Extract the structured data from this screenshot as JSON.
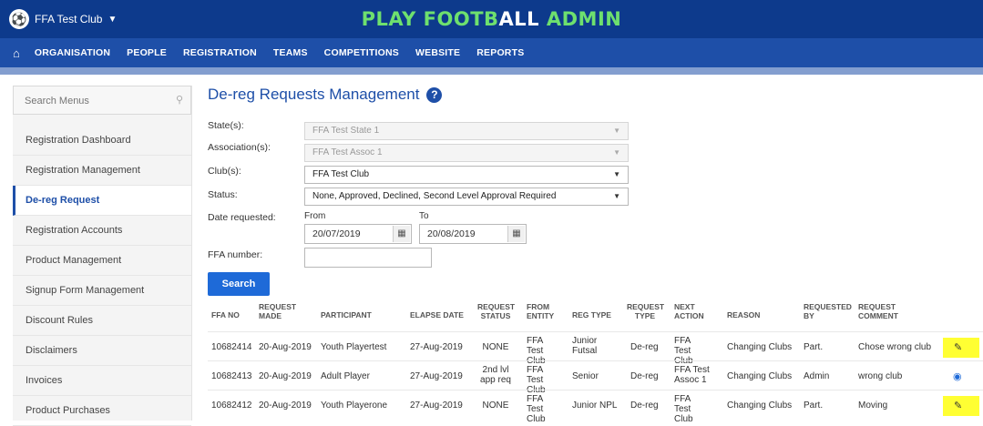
{
  "header": {
    "club_name": "FFA Test Club",
    "title_part1": "PLAY FOOTB",
    "title_part2": "ALL ",
    "title_part3": "ADMIN"
  },
  "nav": {
    "items": [
      "ORGANISATION",
      "PEOPLE",
      "REGISTRATION",
      "TEAMS",
      "COMPETITIONS",
      "WEBSITE",
      "REPORTS"
    ]
  },
  "sidebar": {
    "search_placeholder": "Search Menus",
    "items": [
      "Registration Dashboard",
      "Registration Management",
      "De-reg Request",
      "Registration Accounts",
      "Product Management",
      "Signup Form Management",
      "Discount Rules",
      "Disclaimers",
      "Invoices",
      "Product Purchases"
    ],
    "active_item": "De-reg Request"
  },
  "main": {
    "title": "De-reg Requests Management",
    "filters": {
      "state_label": "State(s):",
      "state_value": "FFA Test State 1",
      "association_label": "Association(s):",
      "association_value": "FFA Test Assoc 1",
      "club_label": "Club(s):",
      "club_value": "FFA Test Club",
      "status_label": "Status:",
      "status_value": "None, Approved, Declined, Second Level Approval Required",
      "date_label": "Date requested:",
      "from_label": "From",
      "from_value": "20/07/2019",
      "to_label": "To",
      "to_value": "20/08/2019",
      "ffa_number_label": "FFA number:",
      "ffa_number_value": ""
    },
    "search_button": "Search",
    "table": {
      "headers": [
        "FFA NO",
        "REQUEST MADE",
        "PARTICIPANT",
        "ELAPSE DATE",
        "REQUEST STATUS",
        "FROM ENTITY",
        "REG TYPE",
        "REQUEST TYPE",
        "NEXT ACTION",
        "REASON",
        "REQUESTED BY",
        "REQUEST COMMENT"
      ],
      "rows": [
        {
          "ffa_no": "10682414",
          "request_made": "20-Aug-2019",
          "participant": "Youth Playertest",
          "elapse_date": "27-Aug-2019",
          "request_status": "NONE",
          "from_entity": "FFA Test Club",
          "reg_type": "Junior Futsal",
          "request_type": "De-reg",
          "next_action": "FFA Test Club",
          "reason": "Changing Clubs",
          "requested_by": "Part.",
          "request_comment": "Chose wrong club",
          "action_icon": "pencil-icon",
          "highlight": "#ffff33"
        },
        {
          "ffa_no": "10682413",
          "request_made": "20-Aug-2019",
          "participant": "Adult Player",
          "elapse_date": "27-Aug-2019",
          "request_status": "2nd lvl app req",
          "from_entity": "FFA Test Club",
          "reg_type": "Senior",
          "request_type": "De-reg",
          "next_action": "FFA Test Assoc 1",
          "reason": "Changing Clubs",
          "requested_by": "Admin",
          "request_comment": "wrong club",
          "action_icon": "eye-icon"
        },
        {
          "ffa_no": "10682412",
          "request_made": "20-Aug-2019",
          "participant": "Youth Playerone",
          "elapse_date": "27-Aug-2019",
          "request_status": "NONE",
          "from_entity": "FFA Test Club",
          "reg_type": "Junior NPL",
          "request_type": "De-reg",
          "next_action": "FFA Test Club",
          "reason": "Changing Clubs",
          "requested_by": "Part.",
          "request_comment": "Moving",
          "action_icon": "pencil-icon",
          "highlight": "#ffff33"
        }
      ]
    }
  },
  "colors": {
    "header_bg": "#0d3a8c",
    "nav_bg": "#1e4fa8",
    "title_accent": "#6ee06e",
    "link_blue": "#1e6ad8",
    "highlight_yellow": "#ffff33"
  }
}
